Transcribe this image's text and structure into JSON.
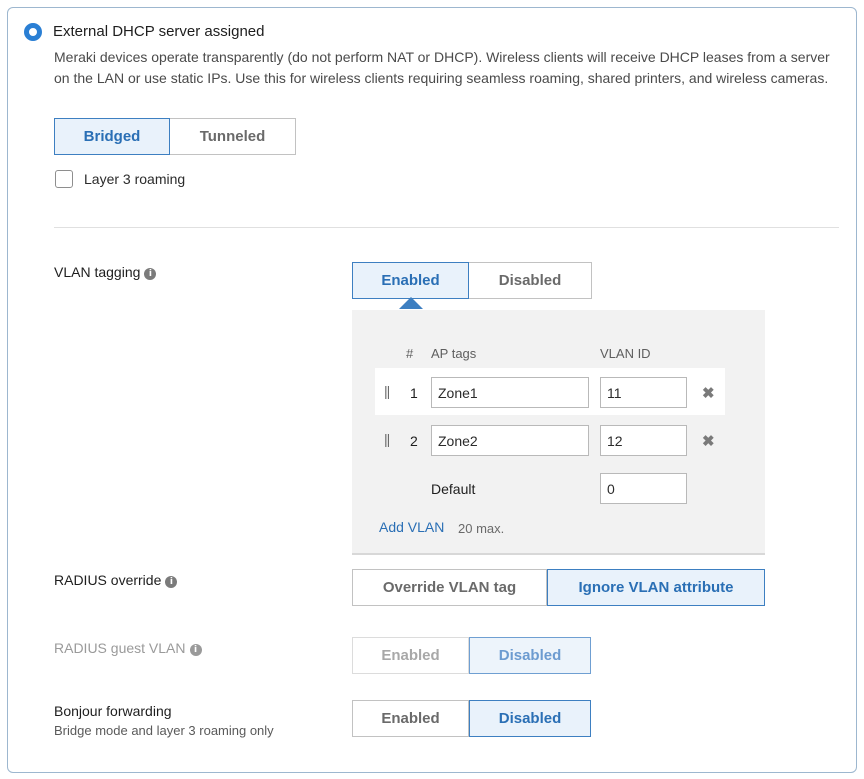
{
  "option": {
    "title": "External DHCP server assigned",
    "description": "Meraki devices operate transparently (do not perform NAT or DHCP). Wireless clients will receive DHCP leases from a server on the LAN or use static IPs. Use this for wireless clients requiring seamless roaming, shared printers, and wireless cameras."
  },
  "mode": {
    "options": [
      "Bridged",
      "Tunneled"
    ],
    "selected": "Bridged"
  },
  "roaming": {
    "label": "Layer 3 roaming",
    "checked": false
  },
  "vlan_tagging": {
    "label": "VLAN tagging",
    "options": [
      "Enabled",
      "Disabled"
    ],
    "selected": "Enabled",
    "table": {
      "headers": {
        "num": "#",
        "ap_tags": "AP tags",
        "vlan_id": "VLAN ID"
      },
      "rows": [
        {
          "num": "1",
          "ap_tags": "Zone1",
          "vlan_id": "11"
        },
        {
          "num": "2",
          "ap_tags": "Zone2",
          "vlan_id": "12"
        }
      ],
      "default": {
        "label": "Default",
        "vlan_id": "0"
      },
      "add_label": "Add VLAN",
      "max_note": "20 max."
    }
  },
  "radius_override": {
    "label": "RADIUS override",
    "options": [
      "Override VLAN tag",
      "Ignore VLAN attribute"
    ],
    "selected": "Ignore VLAN attribute"
  },
  "radius_guest_vlan": {
    "label": "RADIUS guest VLAN",
    "options": [
      "Enabled",
      "Disabled"
    ],
    "selected": "Disabled",
    "disabled": true
  },
  "bonjour": {
    "label": "Bonjour forwarding",
    "sublabel": "Bridge mode and layer 3 roaming only",
    "options": [
      "Enabled",
      "Disabled"
    ],
    "selected": "Disabled"
  },
  "icons": {
    "info": "info-icon",
    "drag": "drag-handle-icon",
    "remove": "close-icon",
    "radio": "radio-selected-icon"
  },
  "colors": {
    "accent": "#2a7fd4",
    "active_bg": "#e9f2fb",
    "active_border": "#3d7fc1",
    "panel_bg": "#f2f2f2",
    "card_border": "#9db7cf"
  }
}
